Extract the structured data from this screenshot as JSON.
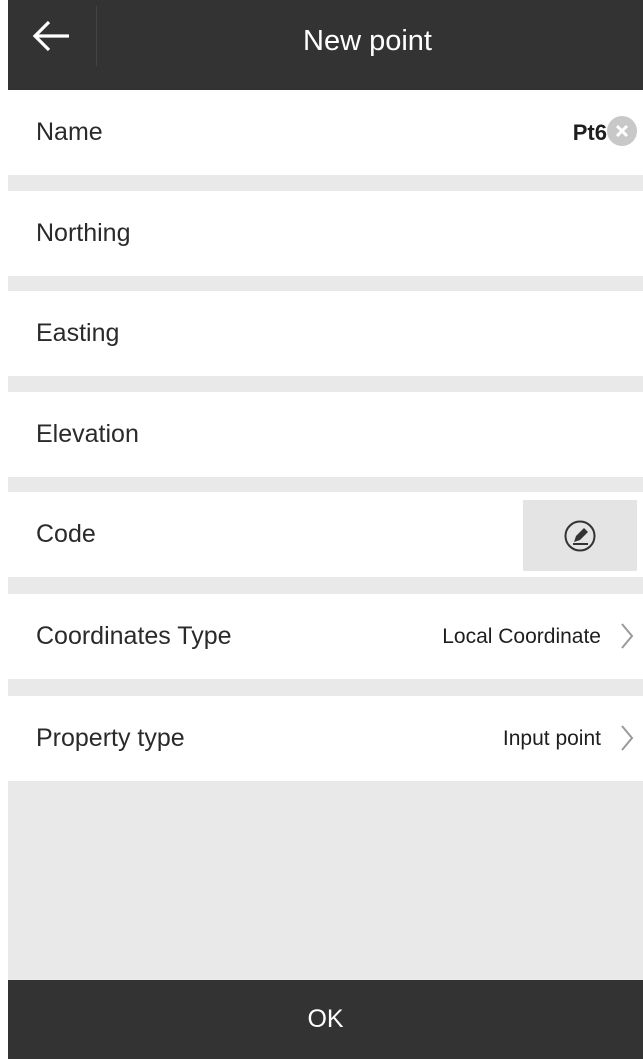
{
  "header": {
    "title": "New point",
    "back_icon": "arrow-left-icon"
  },
  "rows": {
    "name": {
      "label": "Name",
      "value": "Pt6",
      "clear_icon": "clear-circle-icon"
    },
    "northing": {
      "label": "Northing",
      "value": ""
    },
    "easting": {
      "label": "Easting",
      "value": ""
    },
    "elevation": {
      "label": "Elevation",
      "value": ""
    },
    "code": {
      "label": "Code",
      "value": "",
      "edit_icon": "pen-circle-icon"
    },
    "coordinates_type": {
      "label": "Coordinates Type",
      "value": "Local Coordinate",
      "icon": "chevron-right-icon"
    },
    "property_type": {
      "label": "Property type",
      "value": "Input point",
      "icon": "chevron-right-icon"
    }
  },
  "footer": {
    "ok_label": "OK"
  },
  "colors": {
    "bar": "#333333",
    "background": "#e9e9e9",
    "row": "#ffffff",
    "code_button": "#e4e4e4",
    "clear_icon": "#c8c8c8"
  }
}
